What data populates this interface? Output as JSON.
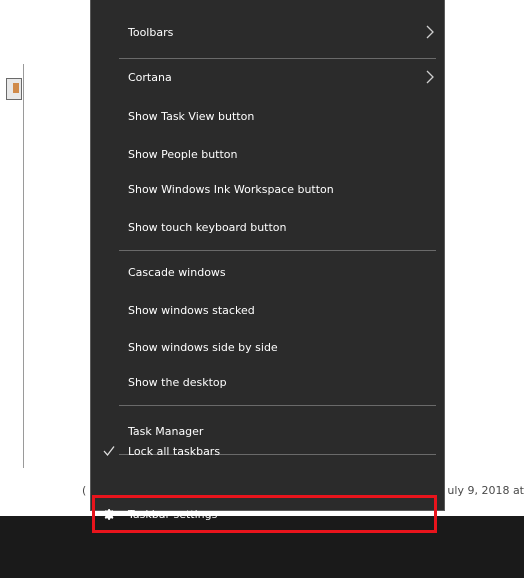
{
  "menu": {
    "items": [
      {
        "label": "Toolbars",
        "submenu": true
      },
      {
        "label": "Cortana",
        "submenu": true
      },
      {
        "label": "Show Task View button"
      },
      {
        "label": "Show People button"
      },
      {
        "label": "Show Windows Ink Workspace button"
      },
      {
        "label": "Show touch keyboard button"
      },
      {
        "label": "Cascade windows"
      },
      {
        "label": "Show windows stacked"
      },
      {
        "label": "Show windows side by side"
      },
      {
        "label": "Show the desktop"
      },
      {
        "label": "Task Manager"
      },
      {
        "label": "Lock all taskbars",
        "checked": true
      },
      {
        "label": "Taskbar settings",
        "icon": "gear-icon"
      }
    ]
  },
  "background": {
    "date_text": "uly 9, 2018 at",
    "left_fragment": "("
  },
  "colors": {
    "menu_bg": "#2b2b2b",
    "menu_text": "#ffffff",
    "separator": "#6a6a6a",
    "highlight": "#e8141c",
    "taskbar": "#1a1a1a"
  }
}
